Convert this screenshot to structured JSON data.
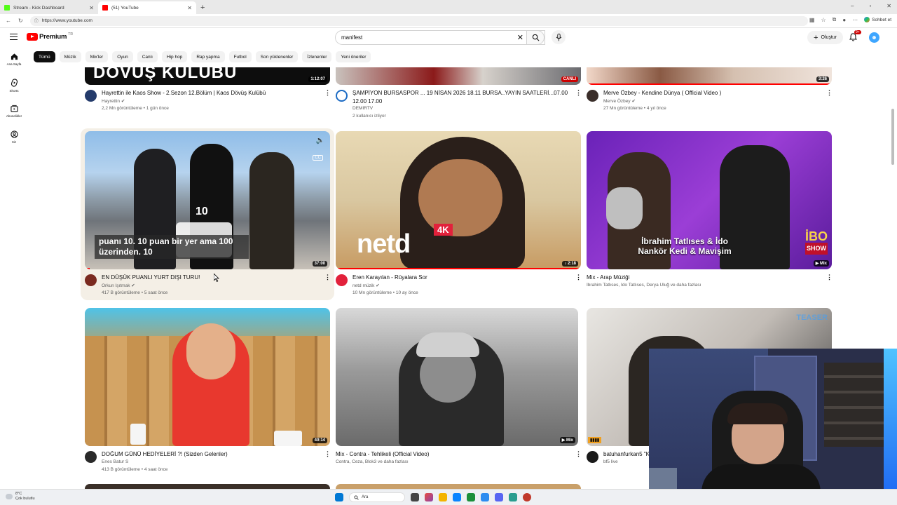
{
  "browser": {
    "tabs": [
      {
        "title": "Stream - Kick Dashboard",
        "color": "#53fc18",
        "active": false
      },
      {
        "title": "(51) YouTube",
        "color": "#ff0000",
        "active": true
      }
    ],
    "url": "https://www.youtube.com",
    "chat_label": "Sohbet et"
  },
  "youtube": {
    "logo_word": "Premium",
    "logo_region": "TR",
    "search_value": "manifest",
    "create_label": "Oluştur",
    "notif_badge": "9+",
    "guide": [
      {
        "label": "Ana Sayfa",
        "icon": "home-icon"
      },
      {
        "label": "Shorts",
        "icon": "shorts-icon"
      },
      {
        "label": "Abonelikler",
        "icon": "subscriptions-icon"
      },
      {
        "label": "Siz",
        "icon": "you-icon"
      }
    ],
    "chips": [
      "Tümü",
      "Müzik",
      "Mix'ler",
      "Oyun",
      "Canlı",
      "Hip hop",
      "Rap yapma",
      "Futbol",
      "Son yüklenenler",
      "İzlenenler",
      "Yeni öneriler"
    ]
  },
  "videos": {
    "row1": [
      {
        "title": "Hayrettin ile Kaos Show - 2.Sezon 12.Bölüm | Kaos Dövüş Kulübü",
        "channel": "Hayrettin",
        "meta": "2,2 Mn görüntüleme • 1 gün önce",
        "duration": "1:12:07",
        "thumb_text": "DÖVÜŞ KULÜBÜ"
      },
      {
        "title": "ŞAMPİYON BURSASPOR ...      19 NİSAN 2026 18.11  BURSA..YAYIN SAATLERİ...07.00",
        "title2": "12.00 17.00",
        "channel": "DEMIRTV",
        "meta": "2 kullanıcı izliyor",
        "duration": "CANLI",
        "live_tag": "CANLI"
      },
      {
        "title": "Merve Özbey - Kendine Dünya ( Official Video )",
        "channel": "Merve Özbey",
        "meta": "27 Mn görüntüleme • 4 yıl önce",
        "duration": "3:26"
      }
    ],
    "row2": [
      {
        "title": "EN DÜŞÜK PUANLI YURT DIŞI TURU!",
        "channel": "Orkun Işıtmak",
        "meta": "417 B görüntüleme • 5 saat önce",
        "duration": "37:00",
        "caption": "puanı 10. 10 puan bir yer ama 100 üzerinden. 10",
        "big_number": "10"
      },
      {
        "title": "Eren Karayılan - Rüyalara Sor",
        "channel": "netd müzik",
        "meta": "10 Mn görüntüleme • 10 ay önce",
        "duration": "2:18",
        "brand": "netd",
        "brand_tag": "4K"
      },
      {
        "title": "Mix - Arap Müziği",
        "channel": "İbrahim Tatlıses, İdo Tatlıses, Derya Uluğ ve daha fazlası",
        "meta": "",
        "duration": "Mix",
        "thumb_text": "İbrahim Tatlıses & İdo",
        "thumb_text2": "Nankör Kedi & Mavişim",
        "show_logo": "İBO",
        "show_logo2": "SHOW"
      }
    ],
    "row3": [
      {
        "title": "DOĞUM GÜNÜ HEDİYELERİ ?! (Sizden Gelenler)",
        "channel": "Enes Batur S",
        "meta": "413 B görüntüleme • 4 saat önce",
        "duration": "40:14"
      },
      {
        "title": "Mix - Contra - Tehlikeli (Official Video)",
        "channel": "Contra, Ceza, Blok3 ve daha fazlası",
        "meta": "",
        "duration": "Mix"
      },
      {
        "title": "batuhanfurkan5 \"K",
        "channel": "bf5 live",
        "meta": "",
        "duration": "",
        "corner_text": "TEASER"
      }
    ]
  },
  "taskbar": {
    "temp": "8°C",
    "weather": "Çok bulutlu",
    "search_label": "Ara"
  },
  "colors": {
    "youtube_red": "#ff0000",
    "accent_blue": "#3ea6ff",
    "netd_red": "#e2213b",
    "ibo_purple": "#7a1fbf"
  }
}
